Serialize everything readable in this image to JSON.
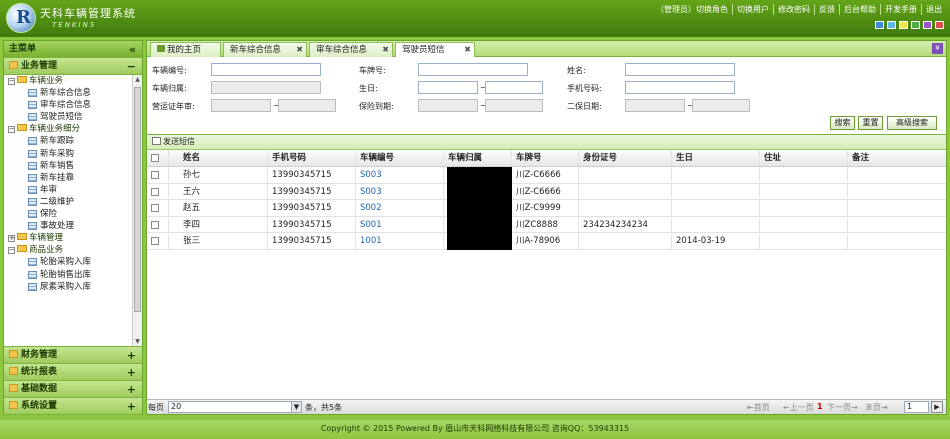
{
  "header": {
    "title": "天科车辆管理系统",
    "subtitle": "TENKINS",
    "logo_letter": "R",
    "links": [
      "（管理员）切换角色",
      "切换用户",
      "修改密码",
      "反馈",
      "后台帮助",
      "开发手册",
      "退出"
    ],
    "skin_colors": [
      "#3f8fd8",
      "#5fb8e8",
      "#e8e84e",
      "#4ab044",
      "#9a55c8",
      "#e05050"
    ]
  },
  "sidebar": {
    "title": "主菜单",
    "collapse_icon": "«",
    "sections": [
      {
        "label": "业务管理",
        "state": "−"
      },
      {
        "label": "财务管理",
        "state": "+"
      },
      {
        "label": "统计报表",
        "state": "+"
      },
      {
        "label": "基础数据",
        "state": "+"
      },
      {
        "label": "系统设置",
        "state": "+"
      }
    ],
    "tree": [
      {
        "type": "group",
        "label": "车辆业务",
        "exp": "−"
      },
      {
        "type": "leaf",
        "label": "新车综合信息"
      },
      {
        "type": "leaf",
        "label": "审车综合信息"
      },
      {
        "type": "leaf",
        "label": "驾驶员短信"
      },
      {
        "type": "group",
        "label": "车辆业务细分",
        "exp": "−"
      },
      {
        "type": "leaf",
        "label": "新车跟踪"
      },
      {
        "type": "leaf",
        "label": "新车采购"
      },
      {
        "type": "leaf",
        "label": "新车销售"
      },
      {
        "type": "leaf",
        "label": "新车挂靠"
      },
      {
        "type": "leaf",
        "label": "年审"
      },
      {
        "type": "leaf",
        "label": "二级维护"
      },
      {
        "type": "leaf",
        "label": "保险"
      },
      {
        "type": "leaf",
        "label": "事故处理"
      },
      {
        "type": "group",
        "label": "车辆管理",
        "exp": "+"
      },
      {
        "type": "group",
        "label": "商品业务",
        "exp": "−"
      },
      {
        "type": "leaf",
        "label": "轮胎采购入库"
      },
      {
        "type": "leaf",
        "label": "轮胎销售出库"
      },
      {
        "type": "leaf",
        "label": "尿素采购入库"
      }
    ]
  },
  "tabs": [
    {
      "label": "我的主页",
      "closable": false,
      "active": false
    },
    {
      "label": "新车综合信息",
      "closable": true,
      "active": false
    },
    {
      "label": "审车综合信息",
      "closable": true,
      "active": false
    },
    {
      "label": "驾驶员短信",
      "closable": true,
      "active": true
    }
  ],
  "tab_menu_icon": "¥",
  "search": {
    "labels": {
      "vehicle_no": "车辆编号:",
      "plate": "车牌号:",
      "name": "姓名:",
      "vehicle_owner": "车辆归属:",
      "birthday": "生日:",
      "phone": "手机号码:",
      "license_review": "营运证年审:",
      "insurance_due": "保险到期:",
      "second_maint": "二保日期:"
    },
    "tilde": "~",
    "buttons": {
      "search": "搜索",
      "reset": "重置",
      "advanced": "高级搜索"
    }
  },
  "toolbar": {
    "send_sms": "发送短信"
  },
  "grid": {
    "columns": [
      "姓名",
      "手机号码",
      "车辆编号",
      "车辆归属",
      "车牌号",
      "身份证号",
      "生日",
      "住址",
      "备注"
    ],
    "rows": [
      {
        "name": "孙七",
        "phone": "13990345715",
        "vehicle_no": "S003",
        "owner": "",
        "plate": "川Z-C6666",
        "id_no": "",
        "birthday": "",
        "address": "",
        "remark": ""
      },
      {
        "name": "王六",
        "phone": "13990345715",
        "vehicle_no": "S003",
        "owner": "",
        "plate": "川Z-C6666",
        "id_no": "",
        "birthday": "",
        "address": "",
        "remark": ""
      },
      {
        "name": "赵五",
        "phone": "13990345715",
        "vehicle_no": "S002",
        "owner": "",
        "plate": "川Z-C9999",
        "id_no": "",
        "birthday": "",
        "address": "",
        "remark": ""
      },
      {
        "name": "李四",
        "phone": "13990345715",
        "vehicle_no": "S001",
        "owner": "",
        "plate": "川ZC8888",
        "id_no": "234234234234",
        "birthday": "",
        "address": "",
        "remark": ""
      },
      {
        "name": "张三",
        "phone": "13990345715",
        "vehicle_no": "1001",
        "owner": "",
        "plate": "川A-78906",
        "id_no": "",
        "birthday": "2014-03-19",
        "address": "",
        "remark": ""
      }
    ]
  },
  "pager": {
    "label": "每页",
    "page_size": "20",
    "total": "条，共5条",
    "first": "首页",
    "prev": "上一页",
    "current": "1",
    "next": "下一页",
    "last": "末页",
    "jump_value": "1",
    "go_icon": "▶"
  },
  "footer": {
    "text": "Copyright © 2015 Powered By 眉山市天科网络科技有限公司 咨询QQ：53943315"
  }
}
